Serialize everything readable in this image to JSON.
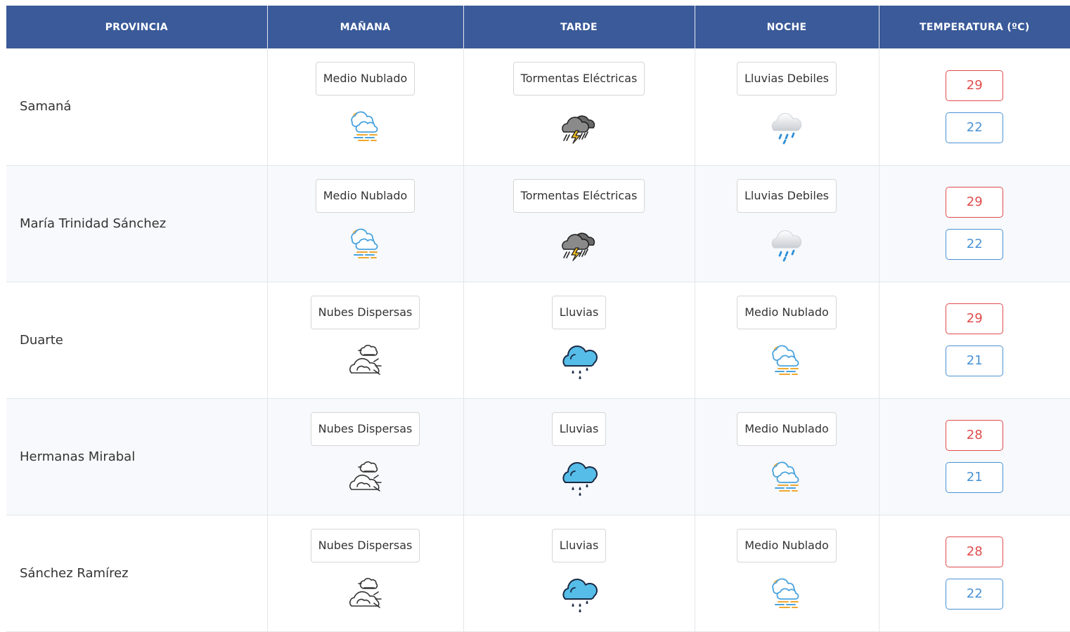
{
  "headers": {
    "provincia": "PROVINCIA",
    "manana": "MAÑANA",
    "tarde": "TARDE",
    "noche": "NOCHE",
    "temperatura": "TEMPERATURA (ºC)"
  },
  "rows": [
    {
      "province": "Samaná",
      "manana": {
        "label": "Medio Nublado",
        "icon": "partly-cloudy-fog-icon"
      },
      "tarde": {
        "label": "Tormentas Eléctricas",
        "icon": "thunderstorm-icon"
      },
      "noche": {
        "label": "Lluvias Debiles",
        "icon": "light-rain-icon"
      },
      "temp_max": "29",
      "temp_min": "22"
    },
    {
      "province": "María Trinidad Sánchez",
      "manana": {
        "label": "Medio Nublado",
        "icon": "partly-cloudy-fog-icon"
      },
      "tarde": {
        "label": "Tormentas Eléctricas",
        "icon": "thunderstorm-icon"
      },
      "noche": {
        "label": "Lluvias Debiles",
        "icon": "light-rain-icon"
      },
      "temp_max": "29",
      "temp_min": "22"
    },
    {
      "province": "Duarte",
      "manana": {
        "label": "Nubes Dispersas",
        "icon": "scattered-clouds-icon"
      },
      "tarde": {
        "label": "Lluvias",
        "icon": "rain-icon"
      },
      "noche": {
        "label": "Medio Nublado",
        "icon": "partly-cloudy-fog-icon"
      },
      "temp_max": "29",
      "temp_min": "21"
    },
    {
      "province": "Hermanas Mirabal",
      "manana": {
        "label": "Nubes Dispersas",
        "icon": "scattered-clouds-icon"
      },
      "tarde": {
        "label": "Lluvias",
        "icon": "rain-icon"
      },
      "noche": {
        "label": "Medio Nublado",
        "icon": "partly-cloudy-fog-icon"
      },
      "temp_max": "28",
      "temp_min": "21"
    },
    {
      "province": "Sánchez Ramírez",
      "manana": {
        "label": "Nubes Dispersas",
        "icon": "scattered-clouds-icon"
      },
      "tarde": {
        "label": "Lluvias",
        "icon": "rain-icon"
      },
      "noche": {
        "label": "Medio Nublado",
        "icon": "partly-cloudy-fog-icon"
      },
      "temp_max": "28",
      "temp_min": "22"
    }
  ],
  "colors": {
    "header_bg": "#3a5a99",
    "max_temp": "#e04b4b",
    "min_temp": "#4a92d4"
  }
}
